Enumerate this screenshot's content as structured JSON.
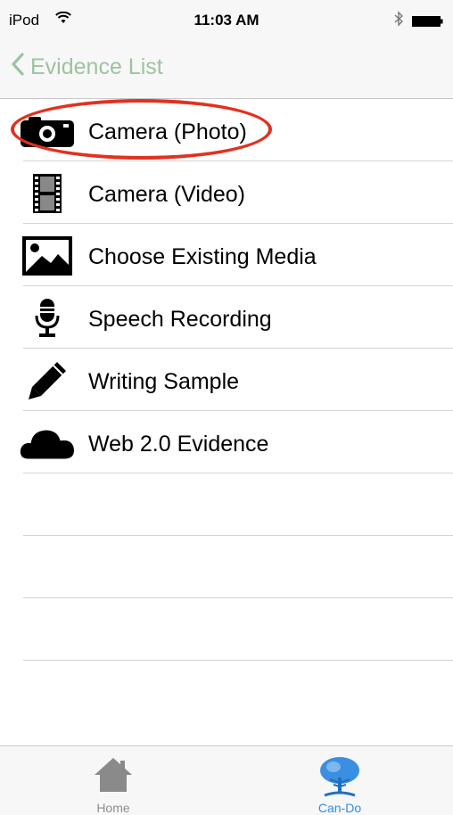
{
  "status_bar": {
    "carrier": "iPod",
    "time": "11:03 AM",
    "wifi_icon": "wifi-icon",
    "bluetooth_icon": "bluetooth-icon",
    "battery_icon": "battery-icon"
  },
  "nav": {
    "back_label": "Evidence List",
    "back_icon": "chevron-left-icon",
    "tint_color": "#9ec3a0"
  },
  "evidence_options": [
    {
      "label": "Camera (Photo)",
      "icon": "camera-icon"
    },
    {
      "label": "Camera (Video)",
      "icon": "film-icon"
    },
    {
      "label": "Choose Existing Media",
      "icon": "image-icon"
    },
    {
      "label": "Speech Recording",
      "icon": "microphone-icon"
    },
    {
      "label": "Writing Sample",
      "icon": "pencil-icon"
    },
    {
      "label": "Web 2.0 Evidence",
      "icon": "cloud-icon"
    }
  ],
  "highlight": {
    "target": "Camera (Photo)",
    "color": "#e2311f"
  },
  "tab_bar": {
    "tabs": [
      {
        "label": "Home",
        "icon": "home-icon",
        "selected": false
      },
      {
        "label": "Can-Do",
        "icon": "tree-icon",
        "selected": true
      }
    ],
    "selected_color": "#2f8ee6"
  }
}
